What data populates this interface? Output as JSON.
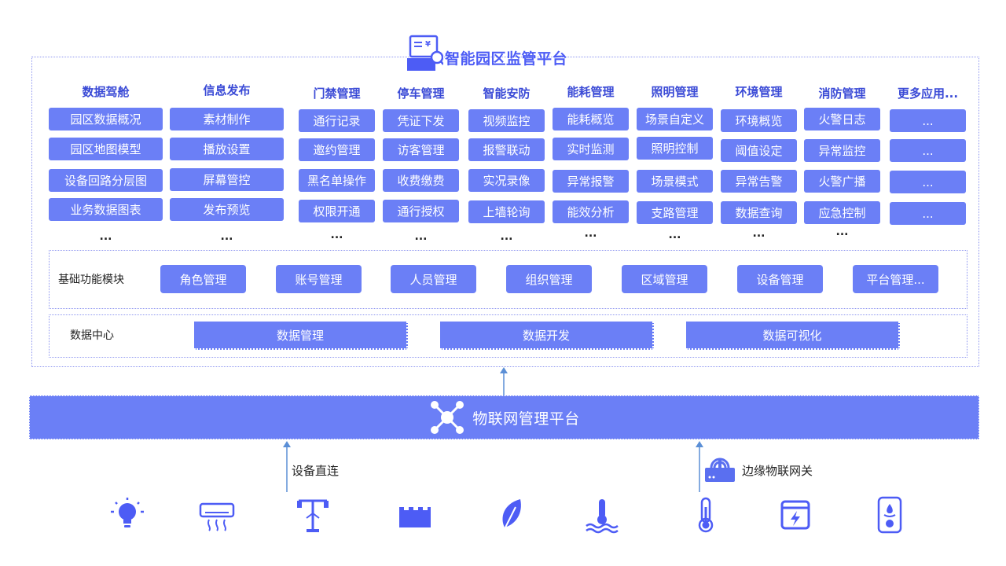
{
  "platform": {
    "title": "智能园区监管平台"
  },
  "columns": [
    {
      "header": "数据驾舱",
      "items": [
        "园区数据概况",
        "园区地图模型",
        "设备回路分层图",
        "业务数据图表"
      ],
      "more": "..."
    },
    {
      "header": "信息发布",
      "items": [
        "素材制作",
        "播放设置",
        "屏幕管控",
        "发布预览"
      ],
      "more": "..."
    },
    {
      "header": "门禁管理",
      "items": [
        "通行记录",
        "邀约管理",
        "黑名单操作",
        "权限开通"
      ],
      "more": "..."
    },
    {
      "header": "停车管理",
      "items": [
        "凭证下发",
        "访客管理",
        "收费缴费",
        "通行授权"
      ],
      "more": "..."
    },
    {
      "header": "智能安防",
      "items": [
        "视频监控",
        "报警联动",
        "实况录像",
        "上墙轮询"
      ],
      "more": "..."
    },
    {
      "header": "能耗管理",
      "items": [
        "能耗概览",
        "实时监测",
        "异常报警",
        "能效分析"
      ],
      "more": "..."
    },
    {
      "header": "照明管理",
      "items": [
        "场景自定义",
        "照明控制",
        "场景模式",
        "支路管理"
      ],
      "more": "..."
    },
    {
      "header": "环境管理",
      "items": [
        "环境概览",
        "阈值设定",
        "异常告警",
        "数据查询"
      ],
      "more": "..."
    },
    {
      "header": "消防管理",
      "items": [
        "火警日志",
        "异常监控",
        "火警广播",
        "应急控制"
      ],
      "more": "..."
    },
    {
      "header": "更多应用...",
      "items": [
        "...",
        "...",
        "...",
        "..."
      ],
      "more": ""
    }
  ],
  "base_module": {
    "label": "基础功能模块",
    "items": [
      "角色管理",
      "账号管理",
      "人员管理",
      "组织管理",
      "区域管理",
      "设备管理",
      "平台管理..."
    ]
  },
  "data_center": {
    "label": "数据中心",
    "items": [
      "数据管理",
      "数据开发",
      "数据可视化"
    ]
  },
  "iot": {
    "title": "物联网管理平台"
  },
  "connections": {
    "direct": "设备直连",
    "gateway": "边缘物联网关"
  },
  "devices": [
    "light-bulb-icon",
    "air-conditioner-icon",
    "street-lamp-icon",
    "building-icon",
    "leaf-icon",
    "water-temperature-icon",
    "thermometer-icon",
    "electric-cabinet-icon",
    "gas-detector-icon"
  ],
  "colors": {
    "accent": "#6b7ff6",
    "title": "#4d5cf5",
    "header": "#3a4ad6",
    "line": "#5b8fd6"
  }
}
